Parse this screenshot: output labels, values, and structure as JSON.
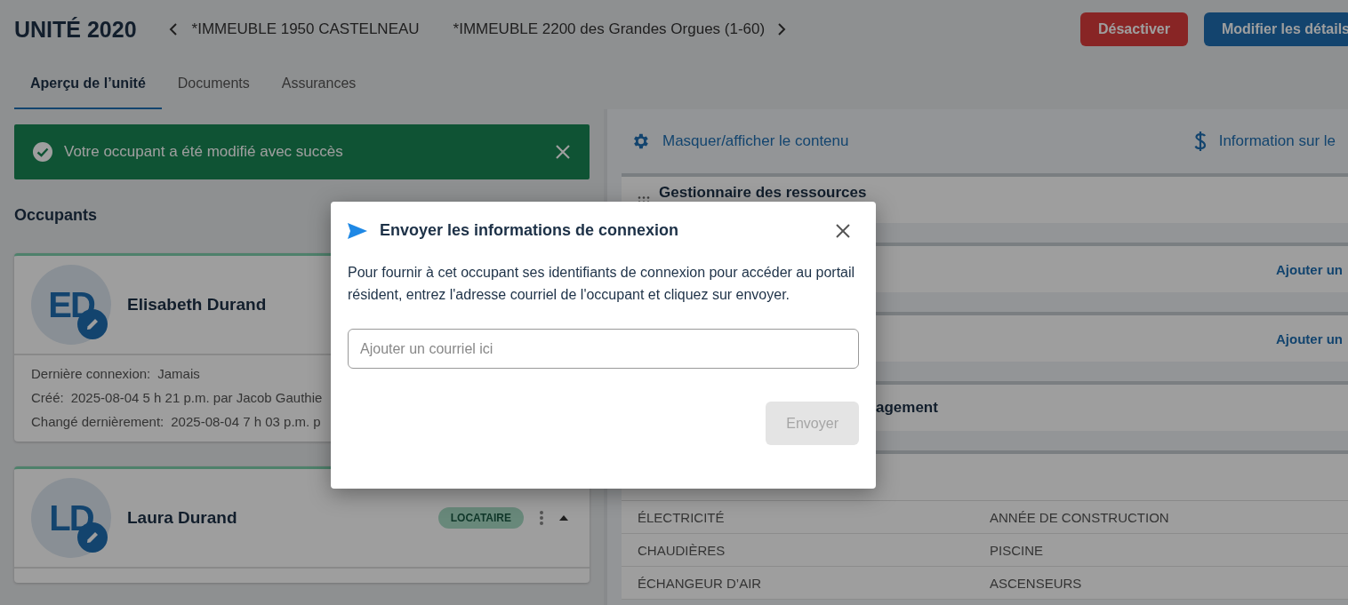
{
  "header": {
    "title": "UNITÉ 2020",
    "breadcrumbs": [
      "*IMMEUBLE 1950 CASTELNEAU",
      "*IMMEUBLE 2200 des Grandes Orgues (1-60)"
    ],
    "buttons": [
      {
        "label": "Désactiver",
        "kind": "danger"
      },
      {
        "label": "Modifier les détails",
        "kind": "primary"
      }
    ]
  },
  "tabs": [
    {
      "label": "Aperçu de l’unité",
      "selected": true
    },
    {
      "label": "Documents",
      "selected": false
    },
    {
      "label": "Assurances",
      "selected": false
    }
  ],
  "toast": {
    "message": "Votre occupant a été modifié avec succès"
  },
  "occupants": {
    "title": "Occupants",
    "cards": [
      {
        "initials": "ED",
        "name": "Elisabeth Durand",
        "details": [
          {
            "label": "Dernière connexion:",
            "value": "Jamais"
          },
          {
            "label": "Créé:",
            "value": "2025-08-04 5 h 21 p.m. par Jacob Gauthie"
          },
          {
            "label": "Changé dernièrement:",
            "value": "2025-08-04 7 h 03 p.m. p"
          }
        ]
      },
      {
        "initials": "LD",
        "name": "Laura Durand",
        "badge": "LOCATAIRE"
      }
    ]
  },
  "right_panel": {
    "actions": [
      {
        "label": "Masquer/afficher le contenu",
        "kind": "gear"
      },
      {
        "label": "Information sur le",
        "kind": "dollar"
      }
    ],
    "sections": [
      {
        "title": "Gestionnaire des ressources",
        "kind": "drag"
      },
      {
        "link": "Ajouter un"
      },
      {
        "link": "Ajouter un"
      },
      {
        "title": "agement"
      }
    ],
    "table": {
      "rows": [
        [
          "ÉLECTRICITÉ",
          "ANNÉE DE CONSTRUCTION"
        ],
        [
          "CHAUDIÈRES",
          "PISCINE"
        ],
        [
          "ÉCHANGEUR D’AIR",
          "ASCENSEURS"
        ]
      ]
    }
  },
  "dialog": {
    "title": "Envoyer les informations de connexion",
    "text": "Pour fournir à cet occupant ses identifiants de connexion pour accéder au portail résident, entrez l'adresse courriel de l'occupant et cliquez sur envoyer.",
    "placeholder": "Ajouter un courriel ici",
    "button": {
      "label": "Envoyer",
      "disabled": true
    }
  }
}
